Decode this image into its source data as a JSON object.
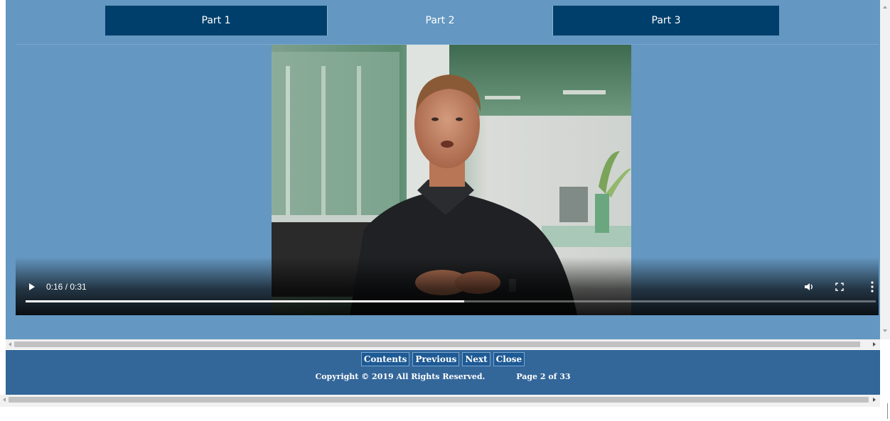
{
  "tabs": [
    {
      "label": "Part 1",
      "active": false
    },
    {
      "label": "Part 2",
      "active": true
    },
    {
      "label": "Part 3",
      "active": false
    }
  ],
  "video": {
    "current_time": "0:16",
    "duration": "0:31",
    "time_label": "0:16 / 0:31",
    "progress_fraction": 0.516,
    "icons": [
      "play-icon",
      "volume-icon",
      "fullscreen-icon",
      "more-options-icon"
    ]
  },
  "footer": {
    "buttons": {
      "contents": "Contents",
      "previous": "Previous",
      "next": "Next",
      "close": "Close"
    },
    "copyright": "Copyright © 2019 All Rights Reserved.",
    "page_indicator": "Page 2 of 33"
  },
  "colors": {
    "frame_bg": "#6497c1",
    "tab_dark": "#003f6b",
    "footer_bg": "#336699"
  }
}
